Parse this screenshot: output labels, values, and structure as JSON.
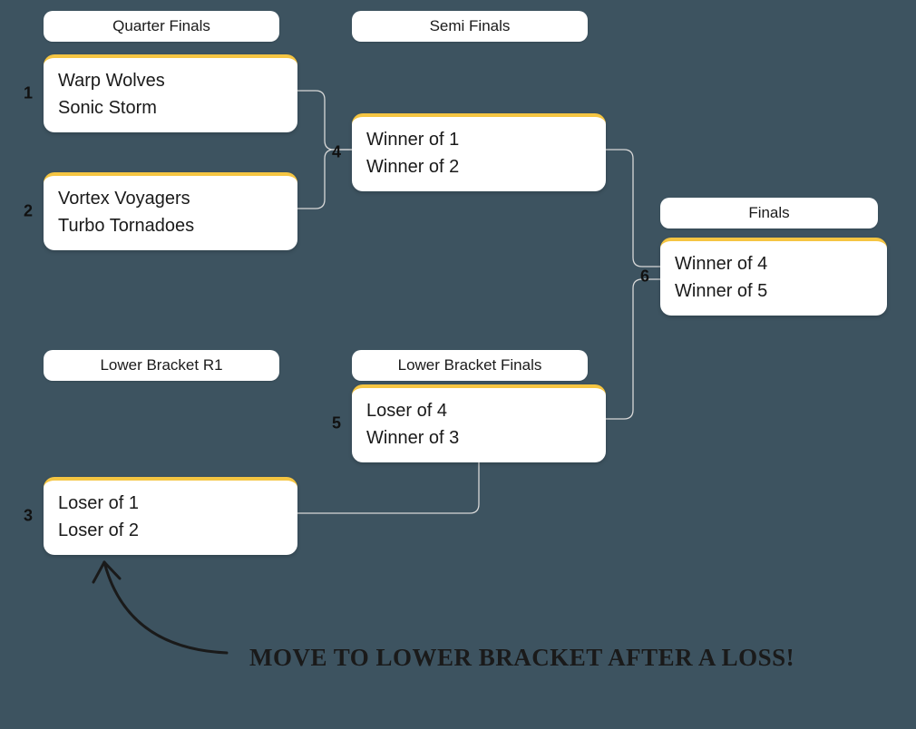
{
  "rounds": {
    "qf": "Quarter Finals",
    "sf": "Semi Finals",
    "lbr1": "Lower Bracket R1",
    "lbf": "Lower Bracket Finals",
    "finals": "Finals"
  },
  "matches": {
    "m1": {
      "num": "1",
      "top": "Warp Wolves",
      "bottom": "Sonic Storm"
    },
    "m2": {
      "num": "2",
      "top": "Vortex Voyagers",
      "bottom": "Turbo Tornadoes"
    },
    "m3": {
      "num": "3",
      "top": "Loser of 1",
      "bottom": "Loser of 2"
    },
    "m4": {
      "num": "4",
      "top": "Winner of 1",
      "bottom": "Winner of 2"
    },
    "m5": {
      "num": "5",
      "top": "Loser of 4",
      "bottom": "Winner of 3"
    },
    "m6": {
      "num": "6",
      "top": "Winner of 4",
      "bottom": "Winner of 5"
    }
  },
  "annotation": "Move to lower bracket after a loss!"
}
